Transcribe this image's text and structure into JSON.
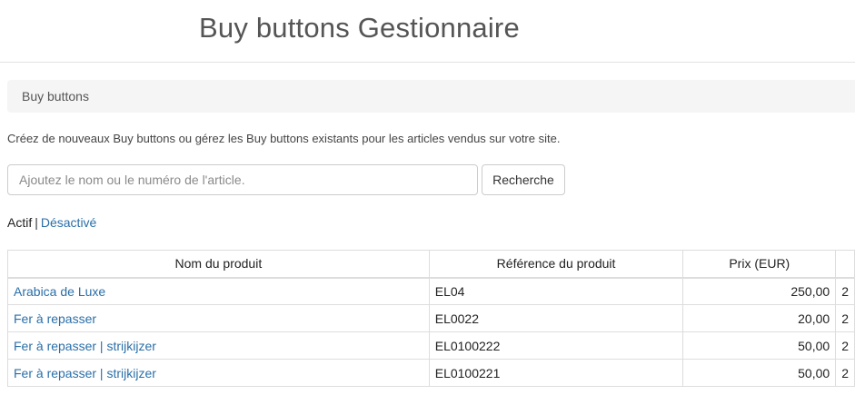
{
  "header": {
    "title": "Buy buttons Gestionnaire"
  },
  "breadcrumb": {
    "label": "Buy buttons"
  },
  "description": "Créez de nouveaux Buy buttons ou gérez les Buy buttons existants pour les articles vendus sur votre site.",
  "search": {
    "placeholder": "Ajoutez le nom ou le numéro de l'article.",
    "value": "",
    "button_label": "Recherche"
  },
  "status_filter": {
    "active_label": "Actif",
    "separator": "|",
    "inactive_label": "Désactivé"
  },
  "table": {
    "headers": [
      "Nom du produit",
      "Référence du produit",
      "Prix (EUR)",
      ""
    ],
    "rows": [
      {
        "name": "Arabica de Luxe",
        "reference": "EL04",
        "price": "250,00",
        "extra": "2"
      },
      {
        "name": "Fer à repasser",
        "reference": "EL0022",
        "price": "20,00",
        "extra": "2"
      },
      {
        "name": "Fer à repasser | strijkijzer",
        "reference": "EL0100222",
        "price": "50,00",
        "extra": "2"
      },
      {
        "name": "Fer à repasser | strijkijzer",
        "reference": "EL0100221",
        "price": "50,00",
        "extra": "2"
      }
    ]
  },
  "colors": {
    "link": "#2a6fa8",
    "breadcrumb_bg": "#f5f5f5",
    "border": "#dddddd"
  }
}
